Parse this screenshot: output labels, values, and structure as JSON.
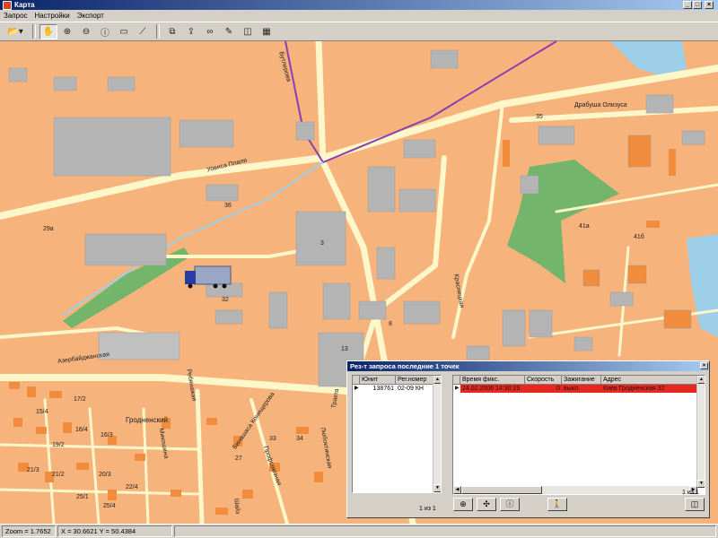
{
  "window": {
    "title": "Карта"
  },
  "menu": [
    "Запрос",
    "Настройки",
    "Экспорт"
  ],
  "toolbar": {
    "icons": [
      "open-folder-icon",
      "hand-pan-icon",
      "zoom-in-icon",
      "zoom-out-icon",
      "info-icon",
      "select-rect-icon",
      "ruler-icon",
      "layer-icon",
      "export-icon",
      "binoculars-icon",
      "pen-icon",
      "eraser-icon",
      "grid-icon"
    ]
  },
  "map": {
    "street_labels": [
      {
        "text": "Бутлерова",
        "name": "street-butlerova"
      },
      {
        "text": "Уовиса Плаля",
        "name": "street-uovisa"
      },
      {
        "text": "Драбуша Олизуса",
        "name": "street-drabusha"
      },
      {
        "text": "Азербайджанская",
        "name": "street-azerbaijanskaya"
      },
      {
        "text": "Гродненский",
        "name": "street-grodnensky"
      },
      {
        "text": "Краснецкая",
        "name": "street-krasnetskaya"
      },
      {
        "text": "Любоктинская",
        "name": "street-lyuboktinskaya"
      },
      {
        "text": "Профсоюзная",
        "name": "street-profsoyuznaya"
      },
      {
        "text": "Микошина",
        "name": "street-mikoshina"
      },
      {
        "text": "Бинашаса Конищерова",
        "name": "street-binashasa"
      },
      {
        "text": "Тракта",
        "name": "street-trakta"
      },
      {
        "text": "Ребянажая",
        "name": "street-rebyanazhaya"
      },
      {
        "text": "Шайз",
        "name": "street-shaiz"
      }
    ],
    "house_numbers": [
      "35",
      "36",
      "3",
      "32",
      "13",
      "8",
      "29а",
      "41а",
      "41б",
      "17/2",
      "15/4",
      "16/4",
      "16/3",
      "19/2",
      "21/3",
      "21/2",
      "20/3",
      "22/4",
      "25/1",
      "25/4",
      "27",
      "33",
      "34"
    ]
  },
  "results_panel": {
    "title": "Рез-т запроса последние 1 точек",
    "left_grid": {
      "columns": [
        "Юнит",
        "Рег.номер"
      ],
      "rows": [
        [
          "138761",
          "02-09 КН"
        ]
      ],
      "pager": "1 из 1"
    },
    "right_grid": {
      "columns": [
        "Время фикс.",
        "Скорость",
        "Зажигание",
        "Адрес"
      ],
      "rows": [
        [
          "24.02.2006 14:30:19",
          "0",
          "выкл.",
          "Киев Гродненская 32"
        ]
      ],
      "pager": "1 из 1"
    },
    "buttons": [
      "zoom-to-icon",
      "center-icon",
      "info-icon",
      "walk-icon",
      "eraser-icon"
    ]
  },
  "status": {
    "zoom": "Zoom = 1.7652",
    "coords": "X = 30.6621 Y = 50.4384"
  },
  "colors": {
    "land": "#f6b37c",
    "building": "#b4b4b4",
    "road": "#fdf7c9",
    "park": "#72b56b",
    "water": "#9ecfe8",
    "boundary": "#8a3fb0",
    "selected_row": "#e8281e"
  }
}
